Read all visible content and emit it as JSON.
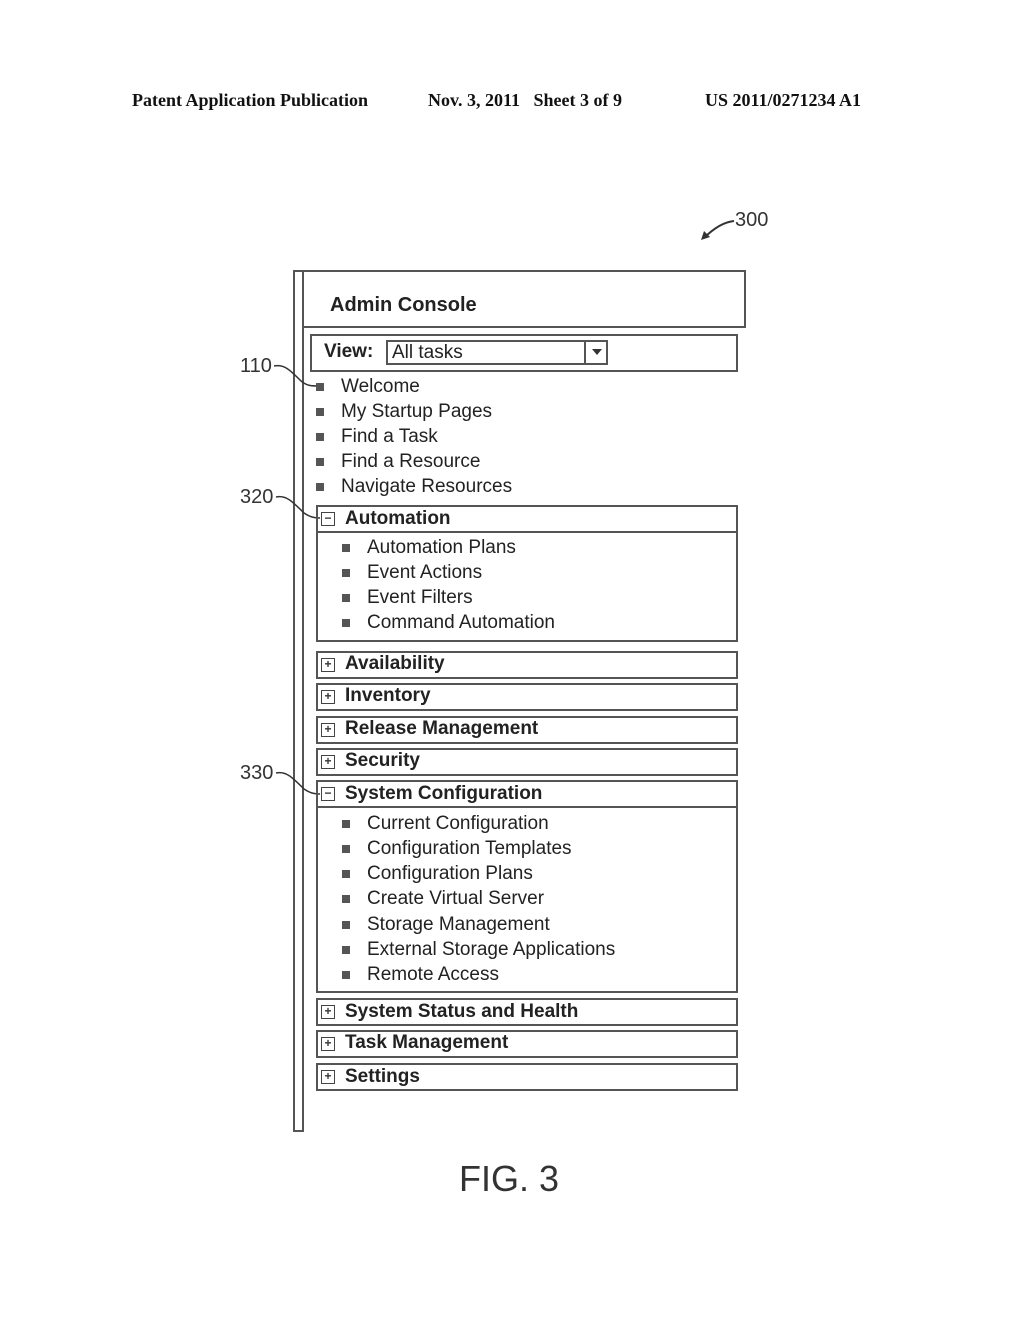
{
  "header": {
    "left": "Patent Application Publication",
    "date_sheet": "Nov. 3, 2011   Sheet 3 of 9",
    "pub_number": "US 2011/0271234 A1"
  },
  "figure_ref": "300",
  "figure_caption": "FIG. 3",
  "callouts": {
    "items": "110",
    "automation": "320",
    "system_config": "330"
  },
  "console": {
    "title": "Admin Console",
    "view_label": "View:",
    "view_value": "All tasks",
    "top_items": [
      "Welcome",
      "My Startup Pages",
      "Find a Task",
      "Find a Resource",
      "Navigate Resources"
    ],
    "groups": [
      {
        "label": "Automation",
        "expanded": true,
        "toggle": "−",
        "items": [
          "Automation Plans",
          "Event Actions",
          "Event Filters",
          "Command Automation"
        ]
      },
      {
        "label": "Availability",
        "expanded": false,
        "toggle": "+"
      },
      {
        "label": "Inventory",
        "expanded": false,
        "toggle": "+"
      },
      {
        "label": "Release Management",
        "expanded": false,
        "toggle": "+"
      },
      {
        "label": "Security",
        "expanded": false,
        "toggle": "+"
      },
      {
        "label": "System Configuration",
        "expanded": true,
        "toggle": "−",
        "items": [
          "Current Configuration",
          "Configuration Templates",
          "Configuration Plans",
          "Create Virtual Server",
          "Storage Management",
          "External Storage Applications",
          "Remote Access"
        ]
      },
      {
        "label": "System Status and Health",
        "expanded": false,
        "toggle": "+"
      },
      {
        "label": "Task Management",
        "expanded": false,
        "toggle": "+"
      },
      {
        "label": "Settings",
        "expanded": false,
        "toggle": "+"
      }
    ]
  }
}
